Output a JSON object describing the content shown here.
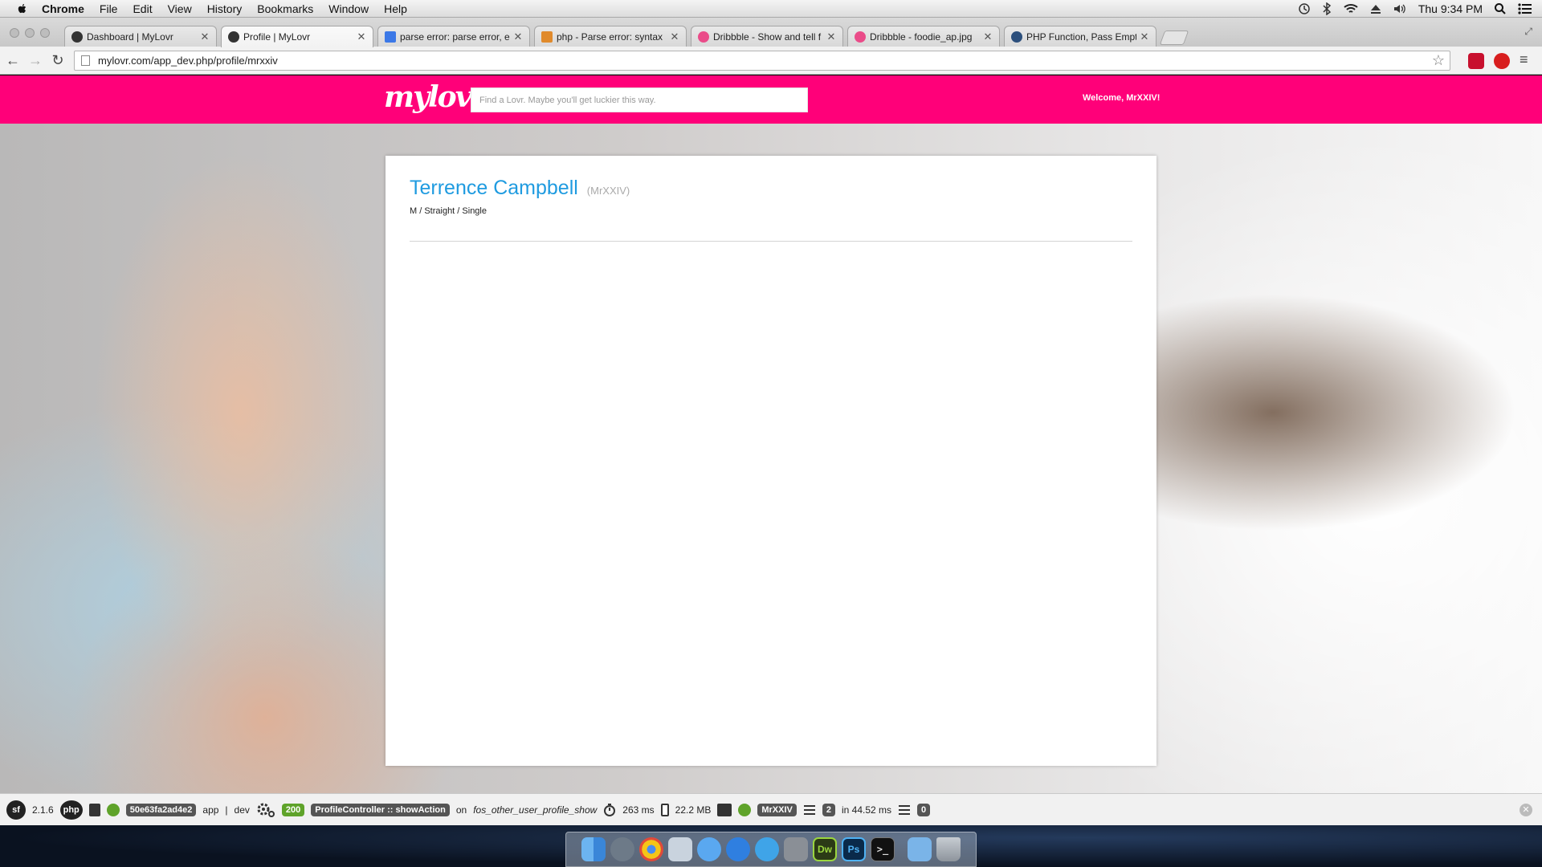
{
  "menubar": {
    "app_name": "Chrome",
    "items": [
      "File",
      "Edit",
      "View",
      "History",
      "Bookmarks",
      "Window",
      "Help"
    ],
    "clock": "Thu 9:34 PM"
  },
  "tabs": [
    {
      "title": "Dashboard | MyLovr",
      "icon": "symfony-favicon",
      "active": false
    },
    {
      "title": "Profile | MyLovr",
      "icon": "symfony-favicon",
      "active": true
    },
    {
      "title": "parse error: parse error, e",
      "icon": "google-favicon",
      "active": false
    },
    {
      "title": "php - Parse error: syntax",
      "icon": "stackoverflow-favicon",
      "active": false
    },
    {
      "title": "Dribbble - Show and tell f",
      "icon": "dribbble-favicon",
      "active": false
    },
    {
      "title": "Dribbble - foodie_ap.jpg",
      "icon": "dribbble-favicon",
      "active": false
    },
    {
      "title": "PHP Function, Pass Empty",
      "icon": "wordpress-favicon",
      "active": false
    }
  ],
  "toolbar": {
    "url": "mylovr.com/app_dev.php/profile/mrxxiv"
  },
  "site": {
    "brand_color": "#ff0079",
    "logo_text": "mylovr",
    "search_placeholder": "Find a Lovr. Maybe you'll get luckier this way.",
    "welcome": "Welcome, MrXXIV!"
  },
  "profile": {
    "full_name": "Terrence Campbell",
    "username": "(MrXXIV)",
    "meta": "M / Straight / Single",
    "name_color": "#1f9be0"
  },
  "debug_toolbar": {
    "symfony_version": "2.1.6",
    "php_label": "php",
    "token": "50e63fa2ad4e2",
    "app": "app",
    "env": "dev",
    "status": "200",
    "controller": "ProfileController :: showAction",
    "on_label": "on",
    "route": "fos_other_user_profile_show",
    "time": "263 ms",
    "memory": "22.2 MB",
    "user": "MrXXIV",
    "queries": "2",
    "query_time": "in 44.52 ms",
    "logs": "0"
  },
  "dock": {
    "icons": [
      "finder-icon",
      "launchpad-icon",
      "chrome-icon",
      "mail-icon",
      "messages-icon",
      "app-store-icon",
      "itunes-icon",
      "system-preferences-icon",
      "dreamweaver-icon",
      "photoshop-icon",
      "terminal-icon",
      "downloads-folder-icon",
      "trash-icon"
    ],
    "dreamweaver_label": "Dw",
    "photoshop_label": "Ps"
  }
}
